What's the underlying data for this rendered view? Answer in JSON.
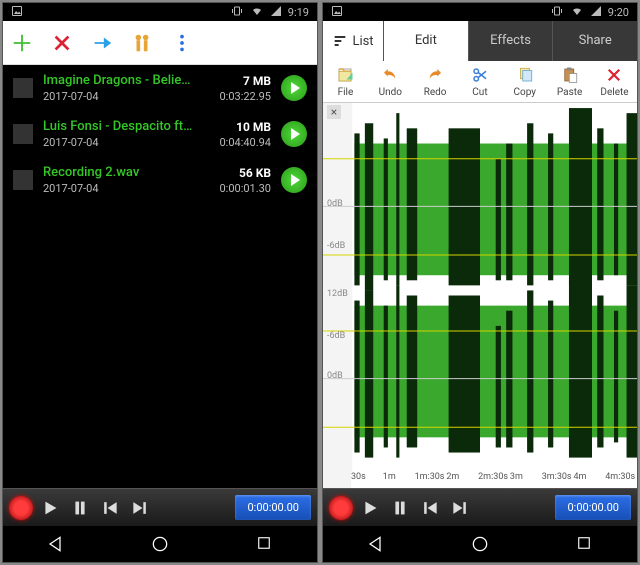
{
  "left": {
    "status": {
      "time": "9:19"
    },
    "tracks": [
      {
        "name": "Imagine Dragons - Believe...",
        "date": "2017-07-04",
        "size": "7 MB",
        "duration": "0:03:22.95"
      },
      {
        "name": "Luis Fonsi - Despacito ft. ...",
        "date": "2017-07-04",
        "size": "10 MB",
        "duration": "0:04:40.94"
      },
      {
        "name": "Recording 2.wav",
        "date": "2017-07-04",
        "size": "56 KB",
        "duration": "0:00:01.30"
      }
    ],
    "player_time": "0:00:00.00"
  },
  "right": {
    "status": {
      "time": "9:20"
    },
    "list_label": "List",
    "tabs": {
      "edit": "Edit",
      "effects": "Effects",
      "share": "Share"
    },
    "tools": {
      "file": "File",
      "undo": "Undo",
      "redo": "Redo",
      "cut": "Cut",
      "copy": "Copy",
      "paste": "Paste",
      "delete": "Delete"
    },
    "db_labels": [
      "0dB",
      "-6dB",
      "12dB",
      "-6dB",
      "0dB"
    ],
    "time_ticks": [
      "30s",
      "1m",
      "1m:30s",
      "2m",
      "2m:30s",
      "3m",
      "3m:30s",
      "4m",
      "4m:30s"
    ],
    "player_time": "0:00:00.00"
  }
}
